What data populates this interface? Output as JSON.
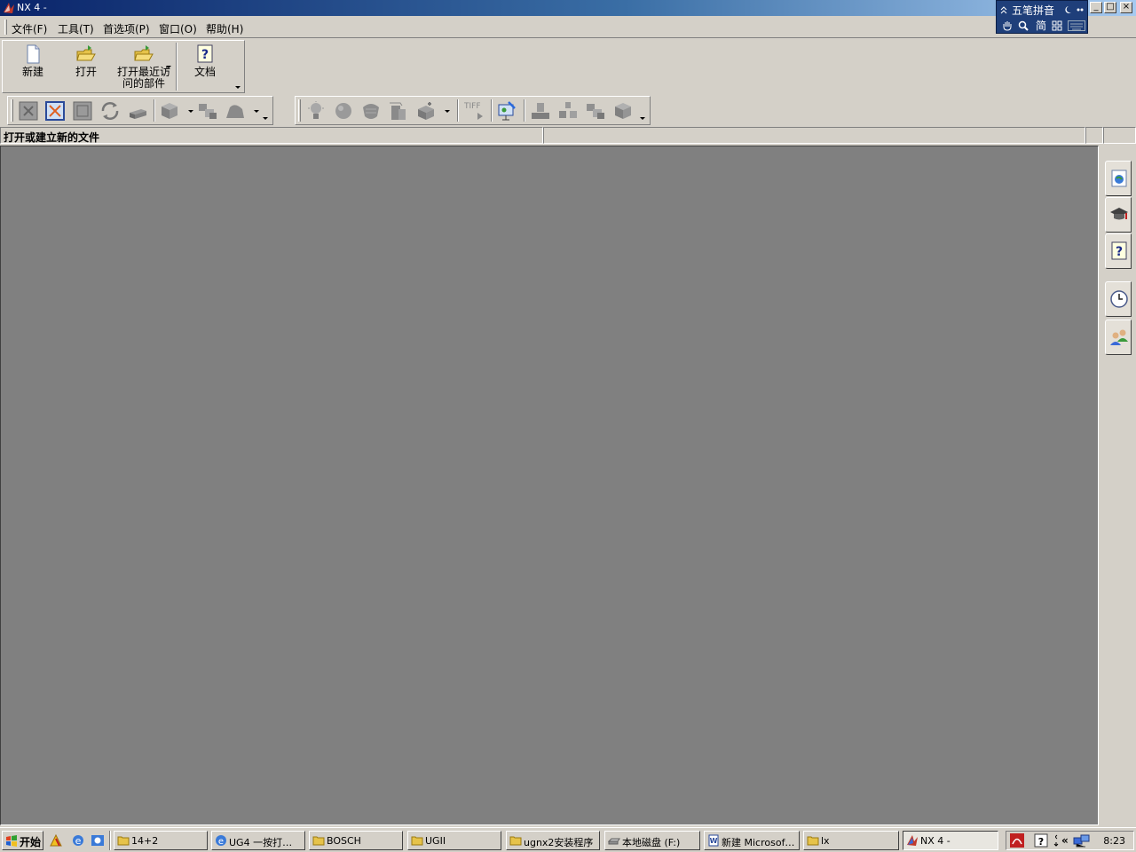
{
  "window": {
    "title": "NX 4 -",
    "min": "_",
    "max": "□",
    "close": "×"
  },
  "ime": {
    "name": "五笔拼音",
    "mode": "简"
  },
  "menu": [
    {
      "label": "文件(F)"
    },
    {
      "label": "工具(T)"
    },
    {
      "label": "首选项(P)"
    },
    {
      "label": "窗口(O)"
    },
    {
      "label": "帮助(H)"
    }
  ],
  "std_toolbar": {
    "new": "新建",
    "open": "打开",
    "recent_line1": "打开最近访",
    "recent_line2": "问的部件",
    "docs": "文档"
  },
  "icons": {
    "toolbar1": [
      "fit-view-icon",
      "zoom-window-icon",
      "zoom-icon",
      "rotate-icon",
      "pan-icon",
      "shaded-cube-icon",
      "shaded-parts-icon",
      "shaded-shape-icon"
    ],
    "toolbar2": [
      "light-bulb-icon",
      "material-icon",
      "texture-icon",
      "render-icon",
      "visualization-icon",
      "tiff-export-icon",
      "presentation-icon",
      "assembly-add-icon",
      "assembly-constraint-icon",
      "assembly-components-icon",
      "assembly-box-icon"
    ]
  },
  "tiff_label": "TIFF",
  "status": {
    "text": "打开或建立新的文件"
  },
  "taskbar": {
    "start": "开始",
    "tasks": [
      {
        "label": "14+2"
      },
      {
        "label": "UG4 一按打…"
      },
      {
        "label": "BOSCH"
      },
      {
        "label": "UGII"
      },
      {
        "label": "ugnx2安装程序"
      },
      {
        "label": "本地磁盘 (F:)"
      },
      {
        "label": "新建 Microsof…"
      },
      {
        "label": "lx"
      },
      {
        "label": "NX 4 -"
      }
    ],
    "clock": "8:23",
    "tray_expand": "«"
  },
  "colors": {
    "titlebar_start": "#0a246a",
    "titlebar_end": "#a6caf0",
    "graphics_bg": "#808080",
    "chrome": "#d4d0c8"
  }
}
